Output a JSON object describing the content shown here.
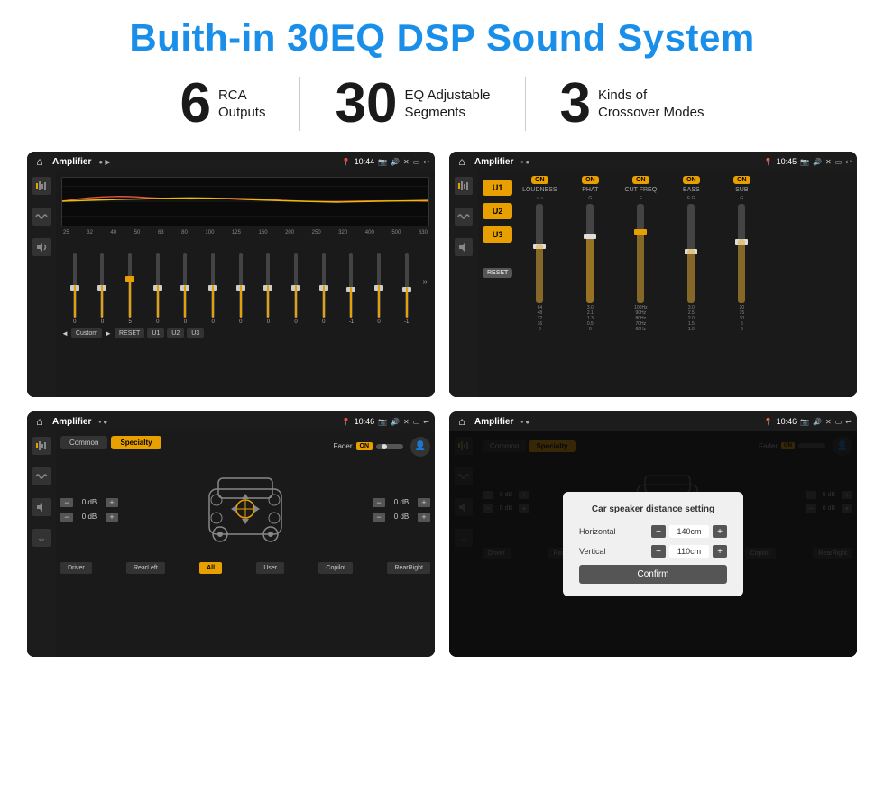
{
  "page": {
    "title": "Buith-in 30EQ DSP Sound System",
    "bg_color": "#ffffff"
  },
  "stats": [
    {
      "number": "6",
      "text_line1": "RCA",
      "text_line2": "Outputs"
    },
    {
      "number": "30",
      "text_line1": "EQ Adjustable",
      "text_line2": "Segments"
    },
    {
      "number": "3",
      "text_line1": "Kinds of",
      "text_line2": "Crossover Modes"
    }
  ],
  "screens": [
    {
      "id": "screen1",
      "time": "10:44",
      "title": "Amplifier",
      "type": "eq",
      "eq_bands": [
        "25",
        "32",
        "40",
        "50",
        "63",
        "80",
        "100",
        "125",
        "160",
        "200",
        "250",
        "320",
        "400",
        "500",
        "630"
      ],
      "eq_values": [
        "0",
        "0",
        "0",
        "5",
        "0",
        "0",
        "0",
        "0",
        "0",
        "0",
        "0",
        "-1",
        "0",
        "-1"
      ],
      "bottom_buttons": [
        "Custom",
        "RESET",
        "U1",
        "U2",
        "U3"
      ]
    },
    {
      "id": "screen2",
      "time": "10:45",
      "title": "Amplifier",
      "type": "amp",
      "u_buttons": [
        "U1",
        "U2",
        "U3"
      ],
      "channels": [
        "LOUDNESS",
        "PHAT",
        "CUT FREQ",
        "BASS",
        "SUB"
      ],
      "channel_on": [
        true,
        true,
        true,
        true,
        true
      ],
      "reset_label": "RESET"
    },
    {
      "id": "screen3",
      "time": "10:46",
      "title": "Amplifier",
      "type": "fader",
      "tabs": [
        "Common",
        "Specialty"
      ],
      "active_tab": "Specialty",
      "fader_label": "Fader",
      "fader_on": "ON",
      "vol_labels": [
        "0 dB",
        "0 dB",
        "0 dB",
        "0 dB"
      ],
      "bottom_buttons": [
        "Driver",
        "RearLeft",
        "All",
        "User",
        "Copilot",
        "RearRight"
      ]
    },
    {
      "id": "screen4",
      "time": "10:46",
      "title": "Amplifier",
      "type": "dialog",
      "dialog_title": "Car speaker distance setting",
      "fields": [
        {
          "label": "Horizontal",
          "value": "140cm"
        },
        {
          "label": "Vertical",
          "value": "110cm"
        }
      ],
      "confirm_label": "Confirm",
      "vol_labels": [
        "0 dB",
        "0 dB"
      ],
      "bottom_buttons": [
        "Driver",
        "RearLeft",
        "All",
        "User",
        "Copilot",
        "RearRight"
      ]
    }
  ]
}
